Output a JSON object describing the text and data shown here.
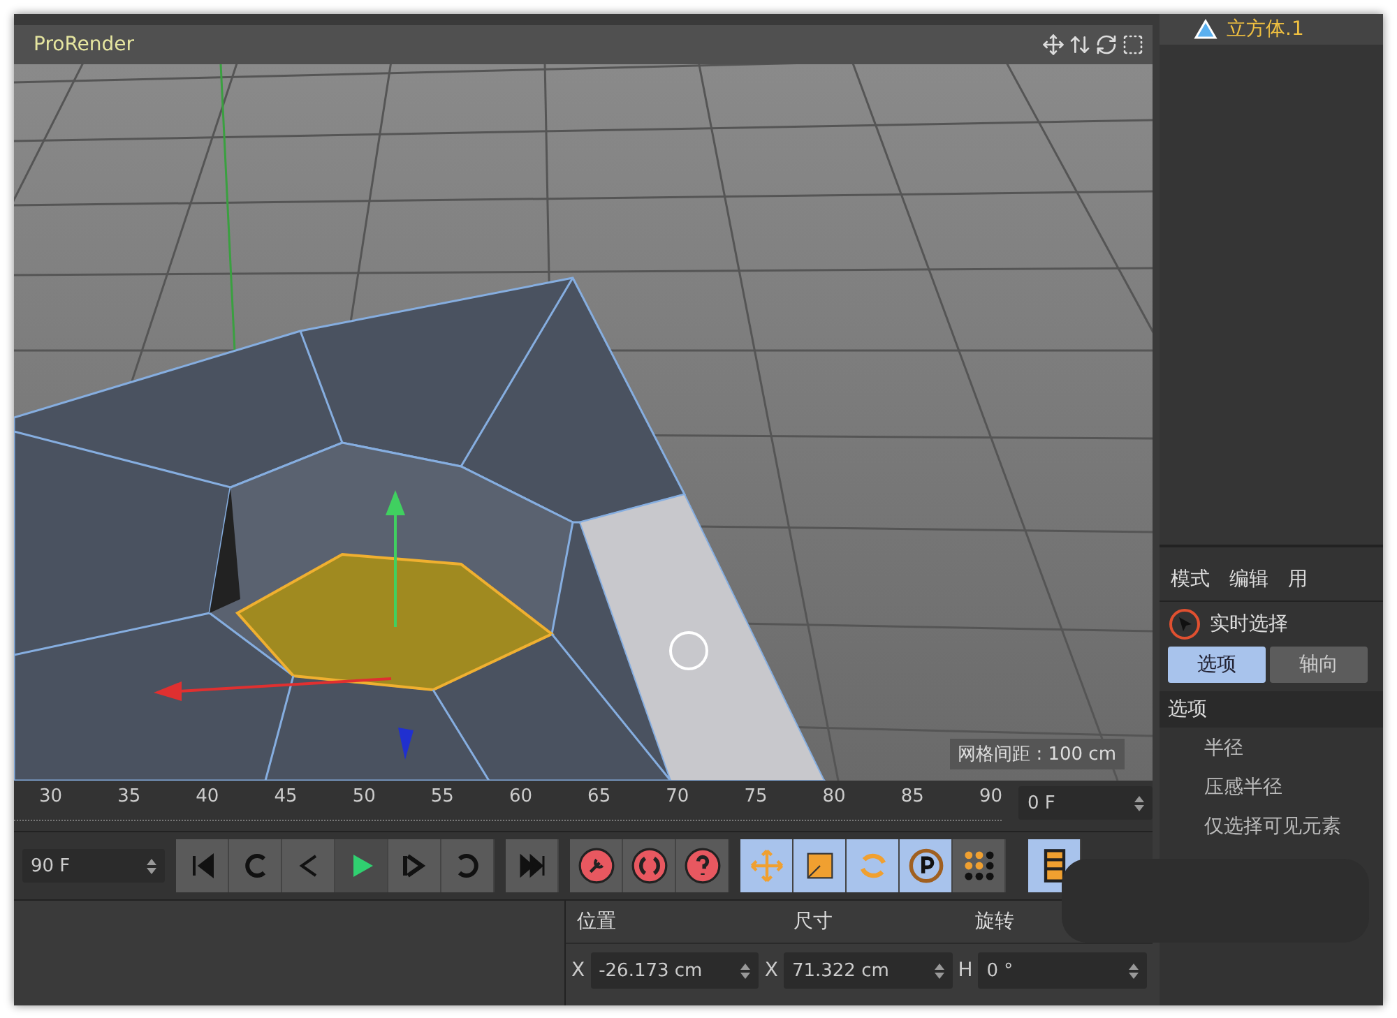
{
  "viewport": {
    "title": "ProRender",
    "grid_label": "网格间距 : 100 cm"
  },
  "objects": [
    {
      "name": "立方体.1"
    }
  ],
  "attributes": {
    "menu": [
      "模式",
      "编辑",
      "用"
    ],
    "tool": "实时选择",
    "tabs": [
      {
        "label": "选项",
        "selected": true
      },
      {
        "label": "轴向",
        "selected": false
      }
    ],
    "section": "选项",
    "properties": [
      "半径",
      "压感半径",
      "仅选择可见元素"
    ]
  },
  "timeline": {
    "ticks": [
      "30",
      "35",
      "40",
      "45",
      "50",
      "55",
      "60",
      "65",
      "70",
      "75",
      "80",
      "85",
      "90"
    ],
    "end_frame": "90 F",
    "current_frame": "0 F"
  },
  "transport": [
    {
      "kind": "start",
      "on": false
    },
    {
      "kind": "prev-key",
      "on": false
    },
    {
      "kind": "prev",
      "on": false
    },
    {
      "kind": "play",
      "on": true
    },
    {
      "kind": "next",
      "on": false
    },
    {
      "kind": "next-key",
      "on": false
    },
    {
      "kind": "end",
      "on": false
    }
  ],
  "keys": [
    {
      "kind": "record"
    },
    {
      "kind": "auto"
    },
    {
      "kind": "help"
    }
  ],
  "tools": [
    {
      "kind": "move",
      "on": true
    },
    {
      "kind": "scale",
      "on": true
    },
    {
      "kind": "rotate",
      "on": true
    },
    {
      "kind": "param",
      "on": true
    },
    {
      "kind": "points",
      "on": false
    },
    {
      "kind": "film",
      "on": true
    }
  ],
  "coordinates": {
    "headers": [
      "位置",
      "尺寸",
      "旋转"
    ],
    "fields": [
      {
        "axis": "X",
        "value": "-26.173 cm"
      },
      {
        "axis": "X",
        "value": "71.322 cm"
      },
      {
        "axis": "H",
        "value": "0 °"
      }
    ]
  }
}
